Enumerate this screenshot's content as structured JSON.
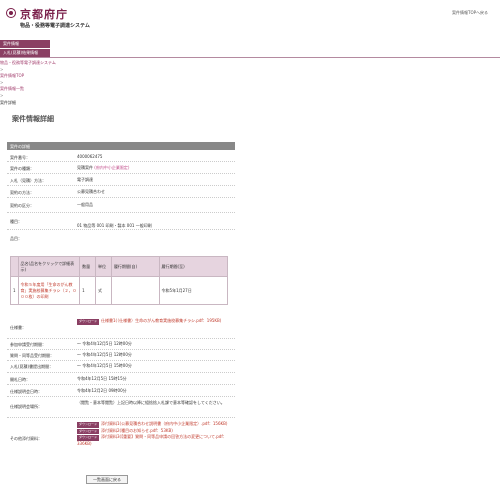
{
  "header": {
    "logo_text": "京都府庁",
    "system_name": "物品・役務等電子調達システム",
    "top_link": "案件情報TOPへ戻る"
  },
  "menu": [
    "案件情報",
    "入札(見積)結果情報"
  ],
  "breadcrumb": [
    "物品・役務等電子調達システム",
    "案件情報TOP",
    "案件情報一覧",
    "案件詳細"
  ],
  "page_title": "案件情報詳細",
  "panel": {
    "header": "案件の詳細",
    "fields": [
      {
        "label": "案件番号：",
        "value": "4000062475"
      },
      {
        "label": "案件の種類：",
        "value": "見積案件",
        "note": "(府内中小企業限定)"
      },
      {
        "label": "入札（見積）方法：",
        "value": "電子調達"
      },
      {
        "label": "契約の方法：",
        "value": "公募見積合わせ"
      },
      {
        "label": "契約の区分：",
        "value": "一般用品"
      },
      {
        "label": "種目：",
        "value": "01 物品等 001 印刷・製本 001 一般印刷"
      },
      {
        "label": "品目：",
        "value": ""
      }
    ],
    "items_table": {
      "headers": [
        "",
        "品名(品名をクリックで詳細表示)",
        "数量",
        "単位",
        "履行期間(自)",
        "履行期間(至)"
      ],
      "rows": [
        {
          "no": "1",
          "name": "令和５年度用「生命のがん教育」実施校募集チラシ（２，０００枚）の印刷",
          "qty": "1",
          "unit": "式",
          "from": "",
          "to": "令和5年1月27日"
        }
      ]
    },
    "details": [
      {
        "label": "仕様書：",
        "badge": "ダウンロード",
        "value": "仕様書1(（仕様書）生命のがん教育実施校募集チラシ.pdf：195KB)"
      },
      {
        "label": "参加申請受付期間：",
        "value": "～ 令和4年12月5日 12時00分"
      },
      {
        "label": "質問・同等品受付期間：",
        "value": "～ 令和4年12月5日 12時00分"
      },
      {
        "label": "入札(見積)書提出期間：",
        "value": "～ 令和4年12月5日 15時00分"
      },
      {
        "label": "開札日時：",
        "value": "令和4年12月5日 15時15分"
      },
      {
        "label": "仕様説明会日時：",
        "value": "令和4年12月2日 09時00分"
      },
      {
        "label": "仕様説明会場所：",
        "value": "（閲覧・意本等閲覧）上記日時以降に組捨捨入札課で意本等確認をしてください。"
      }
    ],
    "attachments_label": "その他添付資料：",
    "attachments": [
      {
        "badge": "ダウンロード",
        "value": "添付資料1(公募見積合わせ説明書（府内中小企業限定）.pdf：156KB)"
      },
      {
        "badge": "ダウンロード",
        "value": "添付資料2(種目のお知らせ.pdf：53KB)"
      },
      {
        "badge": "ダウンロード",
        "value": "添付資料3(【重要】質問・同等品申請の回答方法の変更について.pdf：336KB)"
      }
    ]
  },
  "back_button": "一覧画面に戻る"
}
